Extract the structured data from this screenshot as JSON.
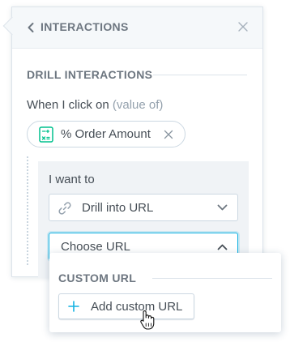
{
  "panel": {
    "title": "INTERACTIONS",
    "back_icon": "chevron-left-icon",
    "close_icon": "close-icon"
  },
  "drill": {
    "section_title": "DRILL INTERACTIONS",
    "when_label": "When I click on",
    "when_hint": "(value of)",
    "attribute": {
      "label": "% Order Amount",
      "icon": "calculator-metric-icon",
      "remove_icon": "close-icon"
    },
    "action": {
      "want_label": "I want to",
      "type_select": {
        "value": "Drill into URL",
        "icon": "link-icon"
      },
      "url_select": {
        "value": "Choose URL",
        "open": true
      }
    }
  },
  "dropdown": {
    "section_title": "CUSTOM URL",
    "add_button_label": "Add custom URL",
    "add_icon": "plus-icon"
  },
  "colors": {
    "accent": "#14b2e2",
    "metric": "#00c18d",
    "text": "#464e56",
    "muted": "#94a1ad"
  }
}
